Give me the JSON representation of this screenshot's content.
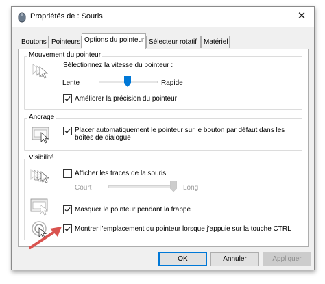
{
  "window": {
    "title": "Propriétés de : Souris",
    "close_glyph": "✕"
  },
  "tabs": [
    {
      "label": "Boutons",
      "active": false
    },
    {
      "label": "Pointeurs",
      "active": false
    },
    {
      "label": "Options du pointeur",
      "active": true
    },
    {
      "label": "Sélecteur rotatif",
      "active": false
    },
    {
      "label": "Matériel",
      "active": false
    }
  ],
  "motion": {
    "title": "Mouvement du pointeur",
    "speed_label": "Sélectionnez la vitesse du pointeur :",
    "slow": "Lente",
    "fast": "Rapide",
    "speed_level": 0.5,
    "precision_label": "Améliorer la précision du pointeur",
    "precision_checked": true
  },
  "snap": {
    "title": "Ancrage",
    "label": "Placer automatiquement le pointeur sur le bouton par défaut dans les boîtes de dialogue",
    "checked": true
  },
  "visibility": {
    "title": "Visibilité",
    "trails_label": "Afficher les traces de la souris",
    "trails_checked": false,
    "short": "Court",
    "long": "Long",
    "trails_level": 1.0,
    "hide_label": "Masquer le pointeur pendant la frappe",
    "hide_checked": true,
    "ctrl_label": "Montrer l'emplacement du pointeur lorsque j'appuie sur la touche CTRL",
    "ctrl_checked": true
  },
  "buttons": {
    "ok": "OK",
    "cancel": "Annuler",
    "apply": "Appliquer"
  },
  "colors": {
    "accent": "#0078d7",
    "annotation_arrow": "#d9534f"
  },
  "icons": [
    "mouse-icon",
    "close-icon",
    "pointer-speed-icon",
    "snap-to-icon",
    "pointer-trails-icon",
    "hide-pointer-icon",
    "show-location-icon",
    "check-icon",
    "annotation-arrow"
  ]
}
